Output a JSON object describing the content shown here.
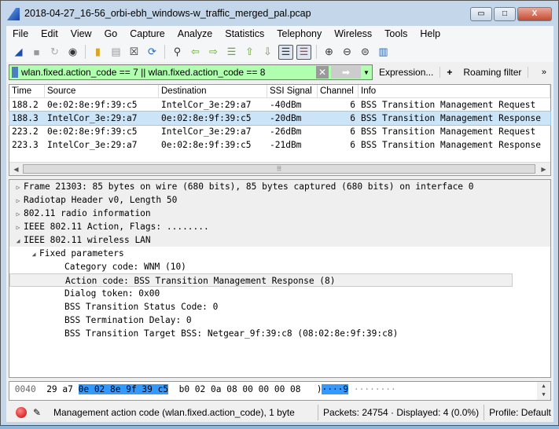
{
  "window": {
    "title": "2018-04-27_16-56_orbi-ebh_windows-w_traffic_merged_pal.pcap",
    "minimize": "▭",
    "maximize": "□",
    "close": "X"
  },
  "menu": [
    "File",
    "Edit",
    "View",
    "Go",
    "Capture",
    "Analyze",
    "Statistics",
    "Telephony",
    "Wireless",
    "Tools",
    "Help"
  ],
  "toolbar_icons": [
    "start-capture-icon",
    "stop-capture-icon",
    "restart-capture-icon",
    "capture-options-icon",
    "open-file-icon",
    "save-file-icon",
    "close-file-icon",
    "reload-icon",
    "find-packet-icon",
    "go-back-icon",
    "go-forward-icon",
    "go-to-packet-icon",
    "first-packet-icon",
    "last-packet-icon",
    "autoscroll-icon",
    "colorize-icon",
    "zoom-in-icon",
    "zoom-out-icon",
    "normal-size-icon",
    "resize-columns-icon"
  ],
  "filter": {
    "value": "wlan.fixed.action_code == 7 || wlan.fixed.action_code == 8",
    "clear": "✕",
    "apply": "➡",
    "dropdown": "▼",
    "expression": "Expression...",
    "add": "+",
    "roaming": "Roaming filter",
    "more": "»",
    "bg_color": "#afffaf"
  },
  "packet_list": {
    "columns": [
      "Time",
      "Source",
      "Destination",
      "SSI Signal",
      "Channel",
      "Info"
    ],
    "rows": [
      [
        "188.2",
        "0e:02:8e:9f:39:c5",
        "IntelCor_3e:29:a7",
        "-40dBm",
        "6",
        "BSS Transition Management Request"
      ],
      [
        "188.3",
        "IntelCor_3e:29:a7",
        "0e:02:8e:9f:39:c5",
        "-20dBm",
        "6",
        "BSS Transition Management Response"
      ],
      [
        "223.2",
        "0e:02:8e:9f:39:c5",
        "IntelCor_3e:29:a7",
        "-26dBm",
        "6",
        "BSS Transition Management Request"
      ],
      [
        "223.3",
        "IntelCor_3e:29:a7",
        "0e:02:8e:9f:39:c5",
        "-21dBm",
        "6",
        "BSS Transition Management Response"
      ]
    ],
    "selected_row": 1
  },
  "details": [
    "Frame 21303: 85 bytes on wire (680 bits), 85 bytes captured (680 bits) on interface 0",
    "Radiotap Header v0, Length 50",
    "802.11 radio information",
    "IEEE 802.11 Action, Flags: ........",
    "IEEE 802.11 wireless LAN",
    "Fixed parameters",
    "Category code: WNM (10)",
    "Action code: BSS Transition Management Response (8)",
    "Dialog token: 0x00",
    "BSS Transition Status Code: 0",
    "BSS Termination Delay: 0",
    "BSS Transition Target BSS: Netgear_9f:39:c8 (08:02:8e:9f:39:c8)"
  ],
  "bytes": {
    "offset": "0040",
    "pre": "29 a7 ",
    "hl": "0e 02 8e 9f 39 c5",
    "post": "  b0 02 0a 08 00 00 00 08",
    "ascii_pre": "   )",
    "ascii_hl": "····9",
    "ascii_post": " ········"
  },
  "status": {
    "field": "Management action code (wlan.fixed.action_code), 1 byte",
    "packets": "Packets: 24754 · Displayed: 4 (0.0%)",
    "profile": "Profile: Default"
  }
}
